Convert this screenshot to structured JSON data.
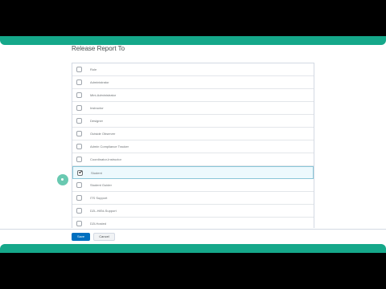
{
  "page": {
    "title": "Release Report To"
  },
  "roles": [
    {
      "label": "Role",
      "checked": false,
      "header": true
    },
    {
      "label": "Administrator",
      "checked": false
    },
    {
      "label": "Mini-Administrator",
      "checked": false
    },
    {
      "label": "Instructor",
      "checked": false
    },
    {
      "label": "Designer",
      "checked": false
    },
    {
      "label": "Outside Observer",
      "checked": false
    },
    {
      "label": "Admin Compliance Tracker",
      "checked": false
    },
    {
      "label": "Coordinator-Instructor",
      "checked": false
    },
    {
      "label": "Student",
      "checked": true
    },
    {
      "label": "Student Guider",
      "checked": false
    },
    {
      "label": "ITS Support",
      "checked": false
    },
    {
      "label": "D2L-HiEd-Support",
      "checked": false
    },
    {
      "label": "D2LHosted",
      "checked": false
    }
  ],
  "actions": {
    "save_label": "Save",
    "cancel_label": "Cancel"
  },
  "colors": {
    "accent_bar": "#15a88a",
    "primary_button": "#006fbf",
    "selected_row": "#edf9fd"
  }
}
